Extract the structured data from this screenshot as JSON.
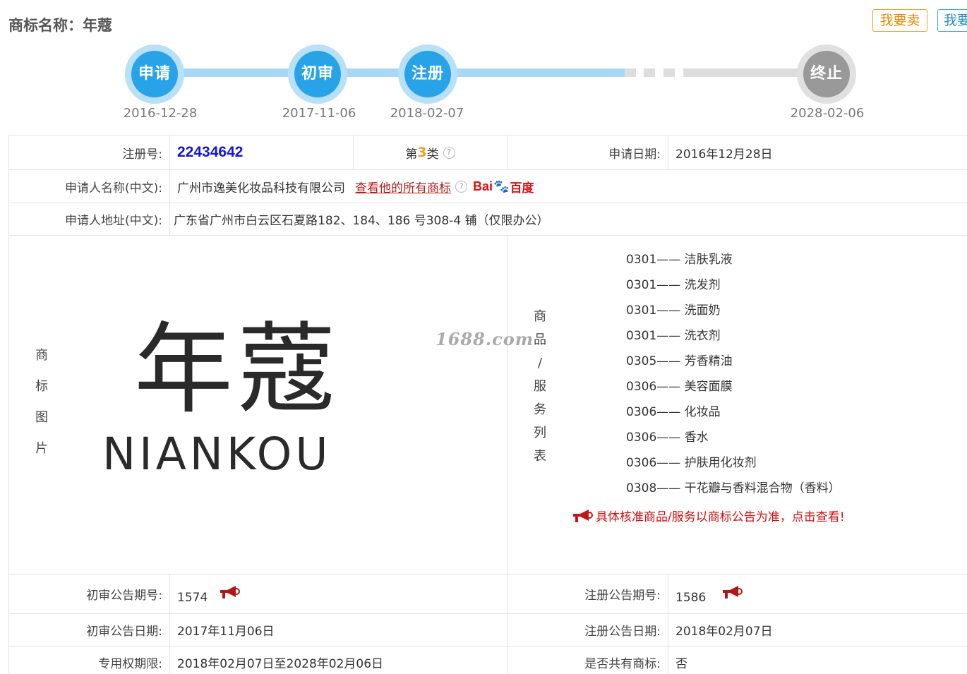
{
  "header": {
    "title": "商标名称：年蔻",
    "sell_button": "我要卖",
    "buy_button": "我要买"
  },
  "timeline": [
    {
      "label": "申请",
      "date": "2016-12-28"
    },
    {
      "label": "初审",
      "date": "2017-11-06"
    },
    {
      "label": "注册",
      "date": "2018-02-07"
    },
    {
      "label": "终止",
      "date": "2028-02-06"
    }
  ],
  "details": {
    "reg_no_label": "注册号:",
    "reg_no": "22434642",
    "class_prefix": "第",
    "class_num": "3",
    "class_suffix": "类",
    "apply_date_label": "申请日期:",
    "apply_date": "2016年12月28日",
    "applicant_label": "申请人名称(中文):",
    "applicant": "广州市逸美化妆品科技有限公司",
    "view_all_link": "查看他的所有商标",
    "baidu_bai": "Bai",
    "baidu_du": "百度",
    "address_label": "申请人地址(中文):",
    "address": "广东省广州市白云区石夏路182、184、186 号308-4 铺（仅限办公）",
    "image_label_chars": [
      "商",
      "标",
      "图",
      "片"
    ],
    "goods_label_chars": [
      "商",
      "品",
      "/",
      "服",
      "务",
      "列",
      "表"
    ],
    "logo_cn": "年蔻",
    "logo_en": "NIANKOU",
    "watermark": "1688.com"
  },
  "goods": [
    {
      "code": "0301",
      "name": "洁肤乳液"
    },
    {
      "code": "0301",
      "name": "洗发剂"
    },
    {
      "code": "0301",
      "name": "洗面奶"
    },
    {
      "code": "0301",
      "name": "洗衣剂"
    },
    {
      "code": "0305",
      "name": "芳香精油"
    },
    {
      "code": "0306",
      "name": "美容面膜"
    },
    {
      "code": "0306",
      "name": "化妆品"
    },
    {
      "code": "0306",
      "name": "香水"
    },
    {
      "code": "0306",
      "name": "护肤用化妆剂"
    },
    {
      "code": "0308",
      "name": "干花瓣与香料混合物（香料）"
    }
  ],
  "goods_separator": "——",
  "goods_notice": "具体核准商品/服务以商标公告为准，点击查看!",
  "announcements": {
    "prelim_issue_label": "初审公告期号:",
    "prelim_issue": "1574",
    "reg_issue_label": "注册公告期号:",
    "reg_issue": "1586",
    "prelim_date_label": "初审公告日期:",
    "prelim_date": "2017年11月06日",
    "reg_date_label": "注册公告日期:",
    "reg_date": "2018年02月07日",
    "term_label": "专用权期限:",
    "term": "2018年02月07日至2028年02月06日",
    "shared_label": "是否共有商标:",
    "shared": "否"
  }
}
